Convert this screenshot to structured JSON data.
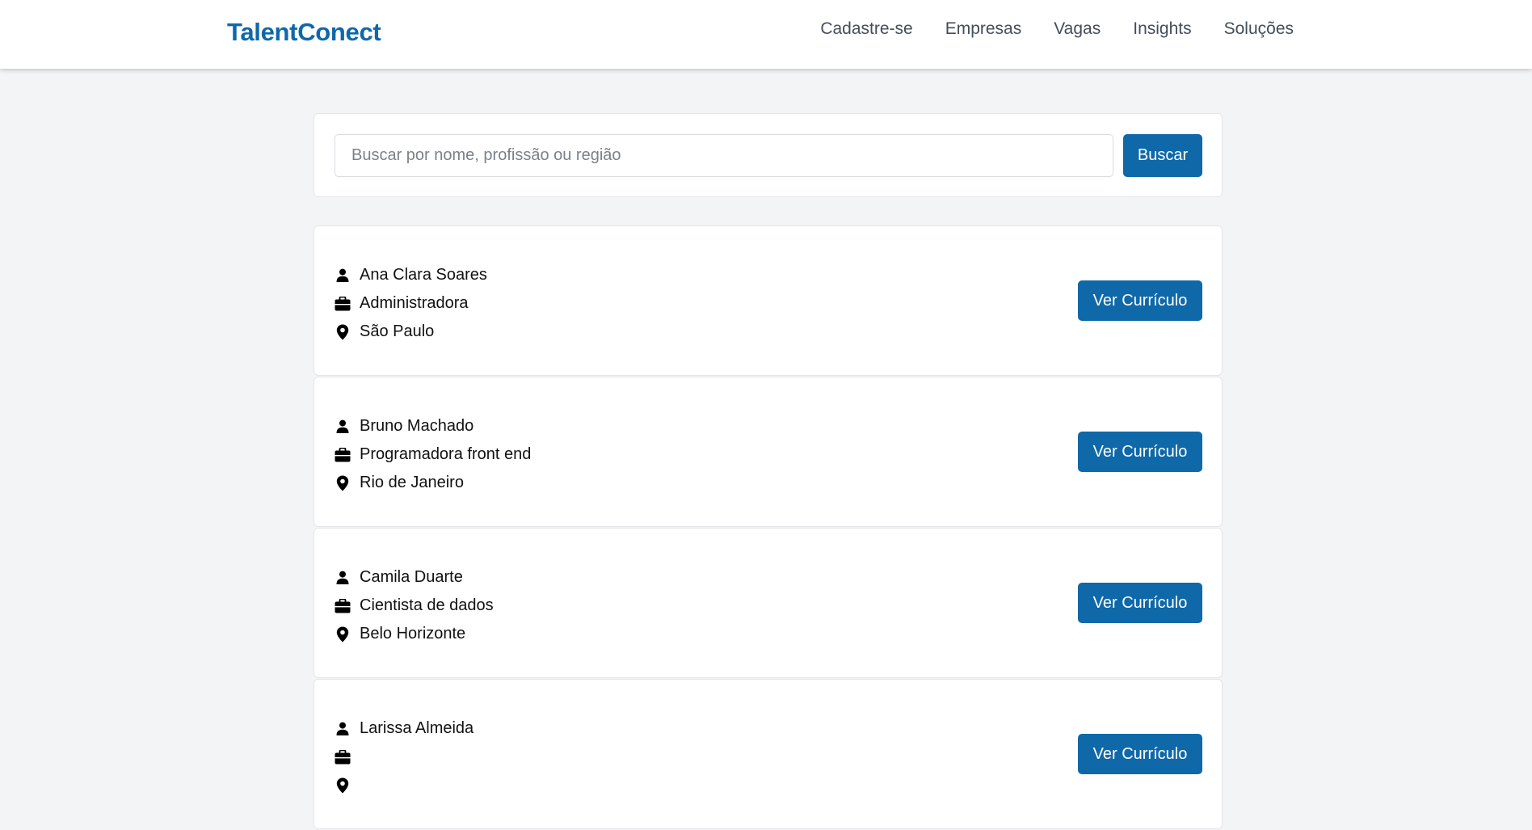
{
  "header": {
    "brand": "TalentConect",
    "nav": [
      "Cadastre-se",
      "Empresas",
      "Vagas",
      "Insights",
      "Soluções"
    ]
  },
  "search": {
    "placeholder": "Buscar por nome, profissão ou região",
    "value": "",
    "button_label": "Buscar"
  },
  "candidates": [
    {
      "name": "Ana Clara Soares",
      "profession": "Administradora",
      "location": "São Paulo",
      "button_label": "Ver Currículo"
    },
    {
      "name": "Bruno Machado",
      "profession": "Programadora front end",
      "location": "Rio de Janeiro",
      "button_label": "Ver Currículo"
    },
    {
      "name": "Camila Duarte",
      "profession": "Cientista de dados",
      "location": "Belo Horizonte",
      "button_label": "Ver Currículo"
    },
    {
      "name": "Larissa Almeida",
      "profession": "",
      "location": "",
      "button_label": "Ver Currículo"
    }
  ],
  "icons": {
    "name": "person-icon",
    "profession": "briefcase-icon",
    "location": "map-pin-icon"
  },
  "colors": {
    "brand": "#0f68a8",
    "page_background": "#f3f4f6",
    "nav_text": "#444d5a"
  }
}
